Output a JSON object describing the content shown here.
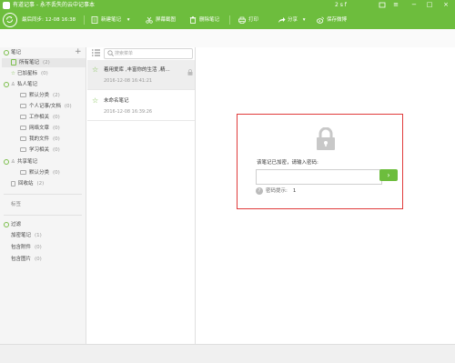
{
  "window": {
    "title": "有道记事 - 永不丢失的云中记事本",
    "user": "2 s f"
  },
  "toolbar": {
    "sync": "最后同步: 12-08 16:38",
    "new_note": "新建笔记",
    "screenshot": "屏幕截图",
    "delete": "删除笔记",
    "print": "打印",
    "share": "分享",
    "share_weibo": "保存微博"
  },
  "sidebar": {
    "notes_header": "笔记",
    "all_notes": {
      "label": "所有笔记",
      "count": "(2)"
    },
    "starred": {
      "label": "已加星标",
      "count": "(0)"
    },
    "private_header": "私人笔记",
    "default_category": {
      "label": "默认分类",
      "count": "(2)"
    },
    "personal_docs": {
      "label": "个人记事/文档",
      "count": "(0)"
    },
    "work": {
      "label": "工作相关",
      "count": "(0)"
    },
    "network_articles": {
      "label": "网络文章",
      "count": "(0)"
    },
    "my_files": {
      "label": "我的文件",
      "count": "(0)"
    },
    "study": {
      "label": "学习相关",
      "count": "(0)"
    },
    "shared_header": "共享笔记",
    "shared_default": {
      "label": "默认分类",
      "count": "(0)"
    },
    "recycle": {
      "label": "回收站",
      "count": "(2)"
    },
    "tags": "标签",
    "filters_header": "过滤",
    "encrypted": {
      "label": "加密笔记",
      "count": "(1)"
    },
    "with_attachments": {
      "label": "包含附件",
      "count": "(0)"
    },
    "with_images": {
      "label": "包含图片",
      "count": "(0)"
    }
  },
  "list": {
    "search_placeholder": "搜索菜单",
    "notes": [
      {
        "title": "着用爱库 ,丰富你的生活 ,精...",
        "date": "2016-12-08 16:41:21"
      },
      {
        "title": "未命名笔记",
        "date": "2016-12-08 16:39:26"
      }
    ]
  },
  "lock": {
    "prompt": "该笔记已加密，请输入密码:",
    "password_value": "",
    "hint_label": "密码提示:",
    "hint_value": "1"
  },
  "colors": {
    "accent": "#6dbd3d",
    "highlight_border": "#e03b3b"
  }
}
